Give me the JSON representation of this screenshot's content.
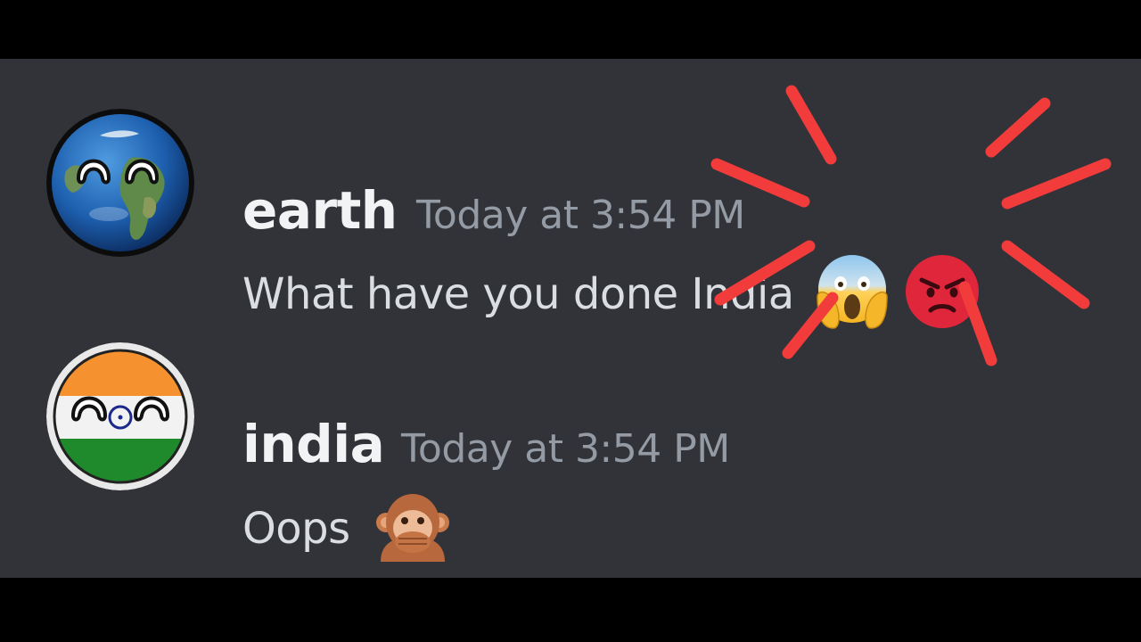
{
  "messages": [
    {
      "username": "earth",
      "timestamp": "Today at 3:54 PM",
      "text": "What have you done India",
      "emojis": [
        "face-screaming-in-fear-icon",
        "pouting-face-icon"
      ]
    },
    {
      "username": "india",
      "timestamp": "Today at 3:54 PM",
      "text": "Oops",
      "emojis": [
        "speak-no-evil-monkey-icon"
      ]
    }
  ],
  "colors": {
    "background": "#313338",
    "username": "#f2f3f5",
    "timestamp": "#949ba4",
    "message_text": "#dbdee1",
    "burst_lines": "#f23c3c"
  }
}
